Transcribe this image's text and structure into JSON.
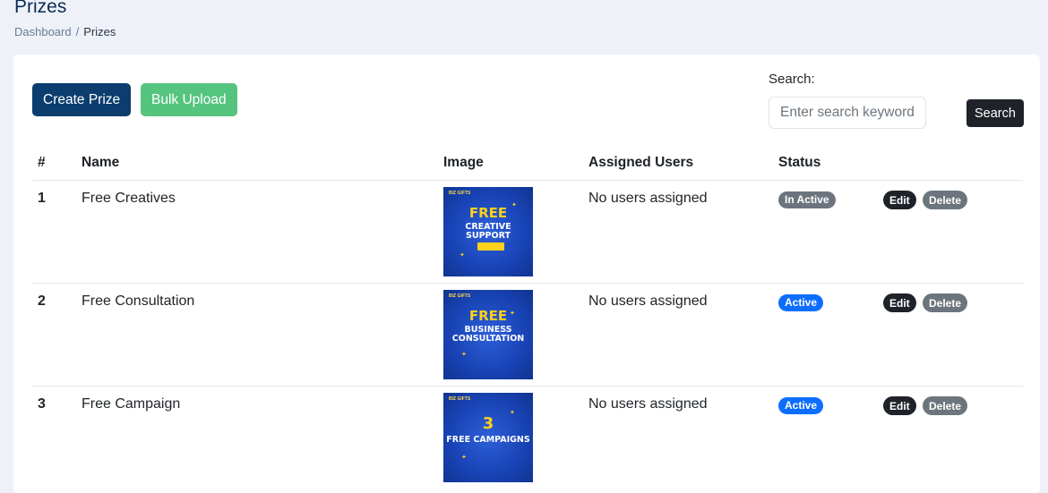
{
  "page": {
    "title": "Prizes"
  },
  "breadcrumb": {
    "home": "Dashboard",
    "separator": "/",
    "current": "Prizes"
  },
  "toolbar": {
    "create_label": "Create Prize",
    "bulk_label": "Bulk Upload"
  },
  "search": {
    "label": "Search:",
    "placeholder": "Enter search keyword",
    "button_label": "Search"
  },
  "table": {
    "headers": {
      "num": "#",
      "name": "Name",
      "image": "Image",
      "users": "Assigned Users",
      "status": "Status"
    },
    "rows": [
      {
        "num": "1",
        "name": "Free Creatives",
        "image": {
          "brand": "BIZ GIFTS",
          "line1": "FREE",
          "line2": "CREATIVE SUPPORT"
        },
        "users": "No users assigned",
        "status": "In Active",
        "status_color": "#6c757d",
        "edit_label": "Edit",
        "delete_label": "Delete"
      },
      {
        "num": "2",
        "name": "Free Consultation",
        "image": {
          "brand": "BIZ GIFTS",
          "line1": "FREE",
          "line2": "BUSINESS CONSULTATION"
        },
        "users": "No users assigned",
        "status": "Active",
        "status_color": "#0d6efd",
        "edit_label": "Edit",
        "delete_label": "Delete"
      },
      {
        "num": "3",
        "name": "Free Campaign",
        "image": {
          "brand": "BIZ GIFTS",
          "line1": "3",
          "line2": "FREE CAMPAIGNS"
        },
        "users": "No users assigned",
        "status": "Active",
        "status_color": "#0d6efd",
        "edit_label": "Edit",
        "delete_label": "Delete"
      }
    ]
  },
  "colors": {
    "primary": "#0b3d6e",
    "success": "#55c47e",
    "dark": "#1f2329",
    "secondary": "#6c757d",
    "info": "#0d6efd"
  }
}
